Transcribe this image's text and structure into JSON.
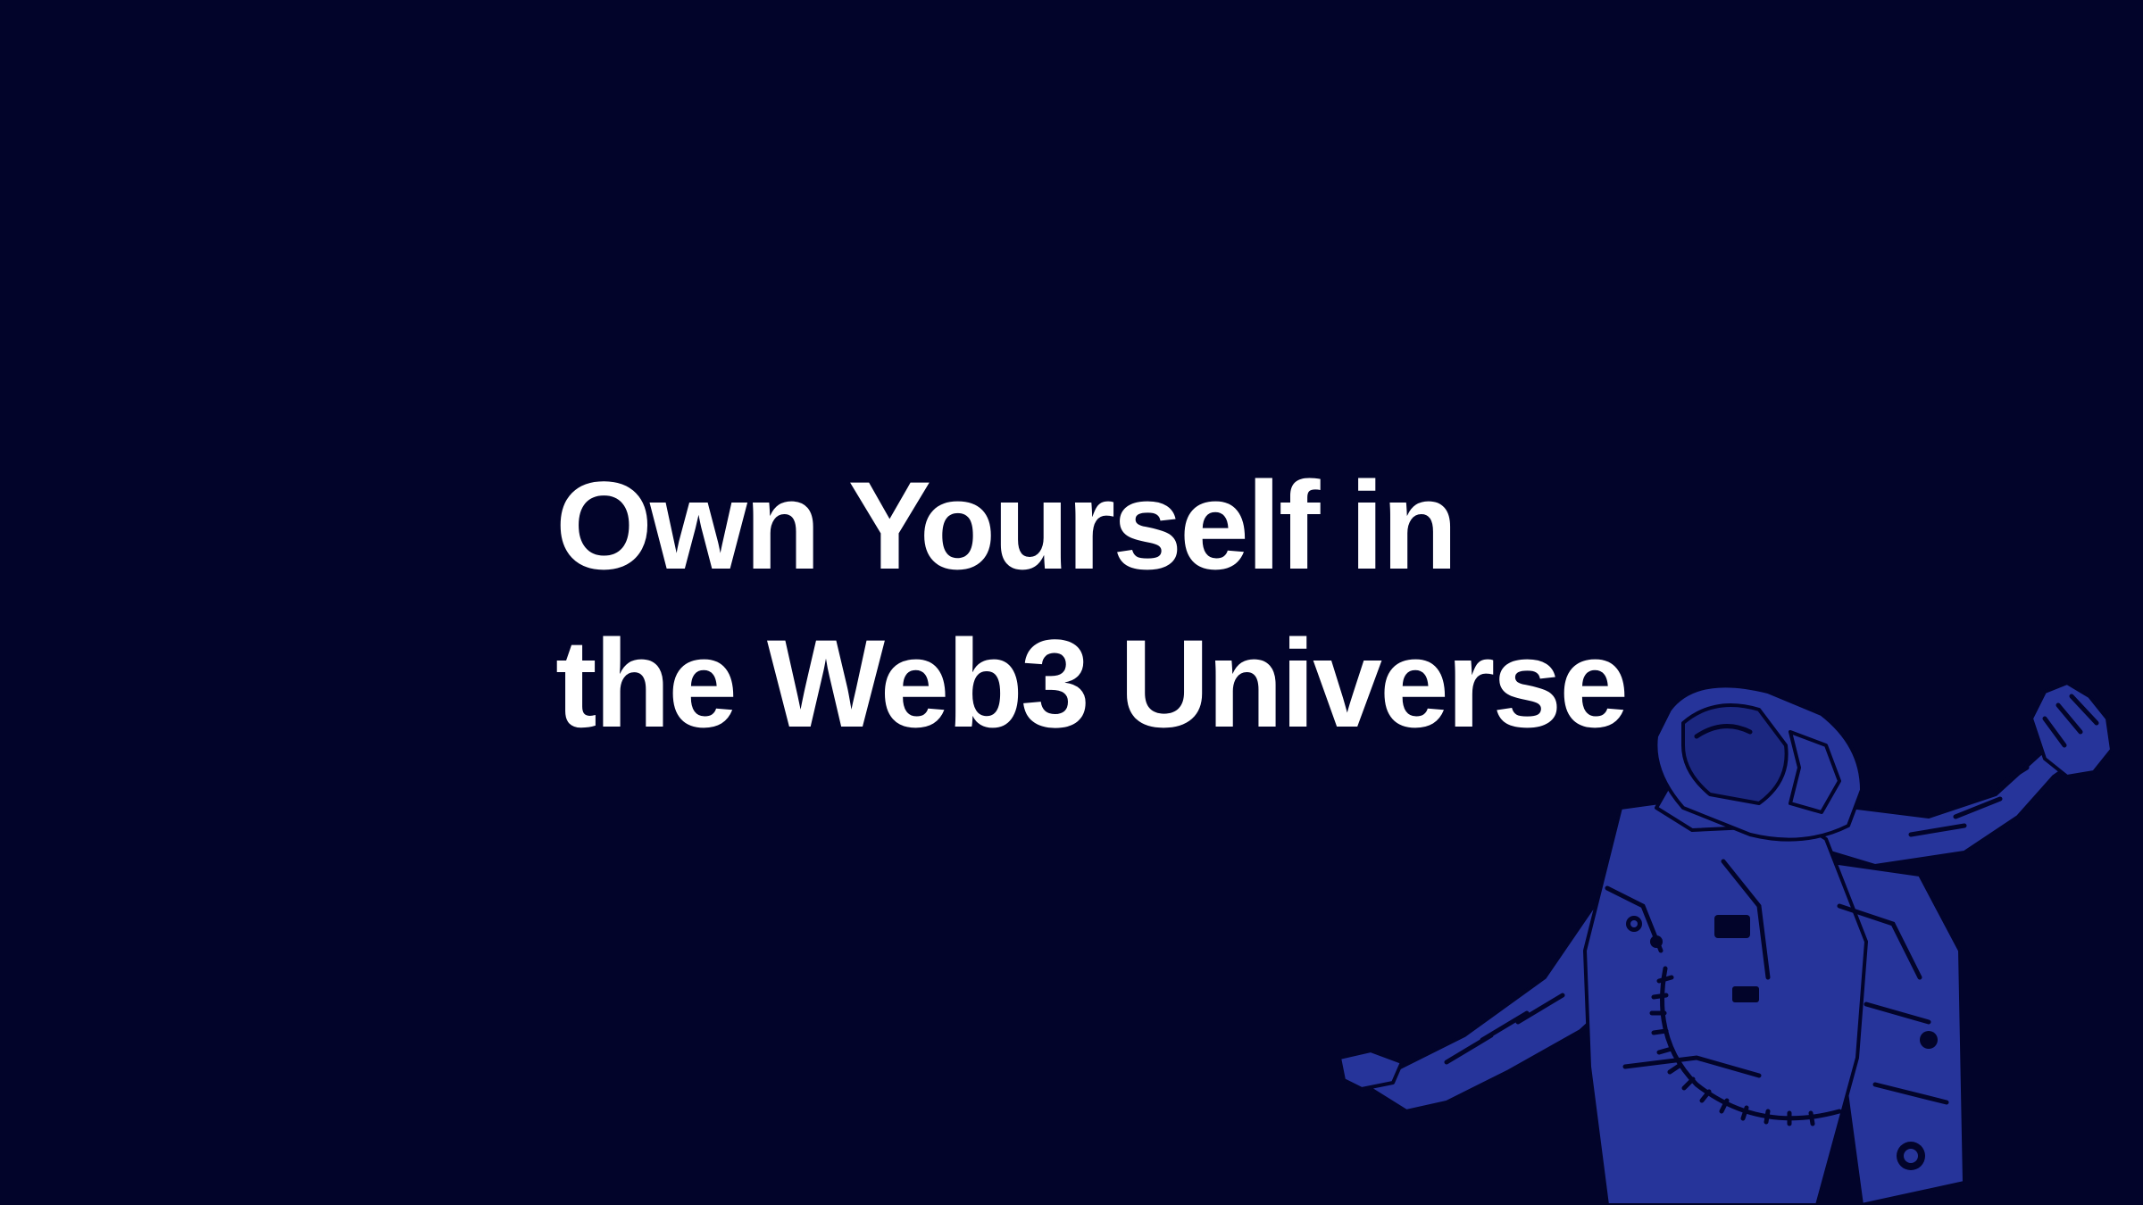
{
  "headline": {
    "line1": "Own Yourself in",
    "line2": "the Web3 Universe"
  },
  "illustration": {
    "subject": "astronaut",
    "icon": "astronaut-illustration"
  },
  "colors": {
    "background": "#02042a",
    "headline_text": "#ffffff",
    "illustration_fill": "#26349a",
    "illustration_line": "#02042a"
  }
}
